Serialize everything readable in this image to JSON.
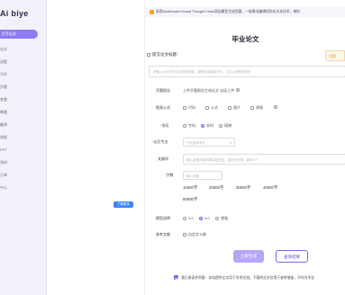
{
  "sidebar": {
    "logo": "Ai biye",
    "active_item": "打写论文",
    "items": [
      "论文",
      "选题",
      "写作",
      "开题",
      "查重",
      "降重",
      "翻译",
      "排版",
      "PPT",
      "答辩",
      "订单",
      "中心"
    ]
  },
  "canvas": {
    "help_pill": "了解更多"
  },
  "banner": {
    "text": "采用Multimodal+Global Thought Chain双因模型生成您要，一般情况编辑续的长文本技术，带你"
  },
  "form": {
    "title": "毕业论文",
    "section_label": "提交论文标题：",
    "tip_badge": "切换",
    "title_placeholder": "请输入6-50字的论文完整标题，该题目将影响写作，中文以获取特别好",
    "outline_label": "开题报告",
    "outline_value": "上传开题报告生成论文  自动上传",
    "figures_label": "图表公式",
    "figures_options": [
      "代码",
      "公式",
      "图片",
      "表格"
    ],
    "degree_label": "学历",
    "degree_options": [
      "专科",
      "本科",
      "硕博"
    ],
    "major_label": "论文专业",
    "major_placeholder": "下拉选择专业",
    "keywords_label": "关键词",
    "keywords_placeholder": "输入多篇关键词提高相关性，用逗号分隔，建议6个",
    "wordcount_label": "字数",
    "wordcount_placeholder": "输入字数",
    "wordcount_options": [
      "10000字",
      "20000字",
      "30000字",
      "40000字",
      "50000字"
    ],
    "model_label": "模型选择",
    "model_options": [
      "3.0",
      "4.0",
      "增强"
    ],
    "refs_label": "参考文献",
    "refs_option": "自定文义献",
    "submit_button": "立即生成",
    "sample_button": "查询结果",
    "agree_text": "我已阅读并同意：本站提供论文用于学术交流，下载的论文仅用于参考借鉴，不作为毕业"
  }
}
